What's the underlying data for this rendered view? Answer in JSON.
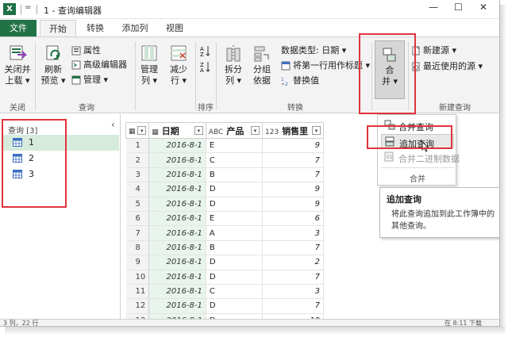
{
  "app": {
    "logo_text": "X",
    "qat_dropdown": "=",
    "title": "1 - 查询编辑器",
    "window_buttons": [
      "—",
      "☐",
      "✕"
    ]
  },
  "tabs": [
    {
      "label": "文件",
      "type": "file"
    },
    {
      "label": "开始",
      "active": true
    },
    {
      "label": "转换"
    },
    {
      "label": "添加列"
    },
    {
      "label": "视图"
    }
  ],
  "ribbon": {
    "close_group": {
      "button": "关闭并",
      "button_line2": "上载 ▾",
      "label": "关闭"
    },
    "query_group": {
      "refresh": "刷新",
      "refresh_line2": "预览 ▾",
      "properties": "属性",
      "advanced_editor": "高级编辑器",
      "manage": "管理 ▾",
      "label": "查询"
    },
    "manage_cols": {
      "line1": "管理",
      "line2": "列 ▾"
    },
    "reduce_rows": {
      "line1": "减少",
      "line2": "行 ▾"
    },
    "sort_label": "排序",
    "transform_group": {
      "split": "拆分",
      "split_line2": "列 ▾",
      "group": "分组",
      "group_line2": "依据",
      "data_type": "数据类型: 日期 ▾",
      "use_first_row": "将第一行用作标题 ▾",
      "replace_values": "替换值",
      "label": "转换"
    },
    "combine_button": {
      "line1": "合",
      "line2": "并 ▾"
    },
    "new_query_group": {
      "new_source": "新建源 ▾",
      "recent_sources": "最近使用的源 ▾",
      "label": "新建查询"
    }
  },
  "left_pane": {
    "title": "查询 [3]",
    "collapse_glyph": "‹",
    "items": [
      "1",
      "2",
      "3"
    ]
  },
  "grid": {
    "columns": [
      {
        "type_icon": "▦",
        "name": ""
      },
      {
        "type_icon": "▦",
        "name": "日期"
      },
      {
        "type_icon": "ABC",
        "name": "产品"
      },
      {
        "type_icon": "123",
        "name": "销售里"
      }
    ],
    "rows": [
      {
        "n": "1",
        "date": "2016-8-1",
        "product": "E",
        "sales": "9"
      },
      {
        "n": "2",
        "date": "2016-8-1",
        "product": "C",
        "sales": "7"
      },
      {
        "n": "3",
        "date": "2016-8-1",
        "product": "B",
        "sales": "7"
      },
      {
        "n": "4",
        "date": "2016-8-1",
        "product": "D",
        "sales": "9"
      },
      {
        "n": "5",
        "date": "2016-8-1",
        "product": "D",
        "sales": "9"
      },
      {
        "n": "6",
        "date": "2016-8-1",
        "product": "E",
        "sales": "6"
      },
      {
        "n": "7",
        "date": "2016-8-1",
        "product": "A",
        "sales": "3"
      },
      {
        "n": "8",
        "date": "2016-8-1",
        "product": "B",
        "sales": "7"
      },
      {
        "n": "9",
        "date": "2016-8-1",
        "product": "D",
        "sales": "2"
      },
      {
        "n": "10",
        "date": "2016-8-1",
        "product": "D",
        "sales": "7"
      },
      {
        "n": "11",
        "date": "2016-8-1",
        "product": "C",
        "sales": "3"
      },
      {
        "n": "12",
        "date": "2016-8-1",
        "product": "D",
        "sales": "7"
      },
      {
        "n": "13",
        "date": "2016-8-1",
        "product": "D",
        "sales": "10"
      }
    ]
  },
  "combine_menu": {
    "items": [
      "合并查询",
      "追加查询",
      "合并二进制数据"
    ],
    "group_label": "合并"
  },
  "tooltip": {
    "title": "追加查询",
    "body": "将此查询追加到此工作簿中的其他查询。"
  },
  "status_bar": {
    "left": "3 列，22 行",
    "right": "在 8:11 下载"
  },
  "colors": {
    "excel_green": "#217346",
    "highlight_red": "#e0333d",
    "date_column_bg": "#e8f4ec",
    "selected_query_bg": "#d6ebdc"
  }
}
